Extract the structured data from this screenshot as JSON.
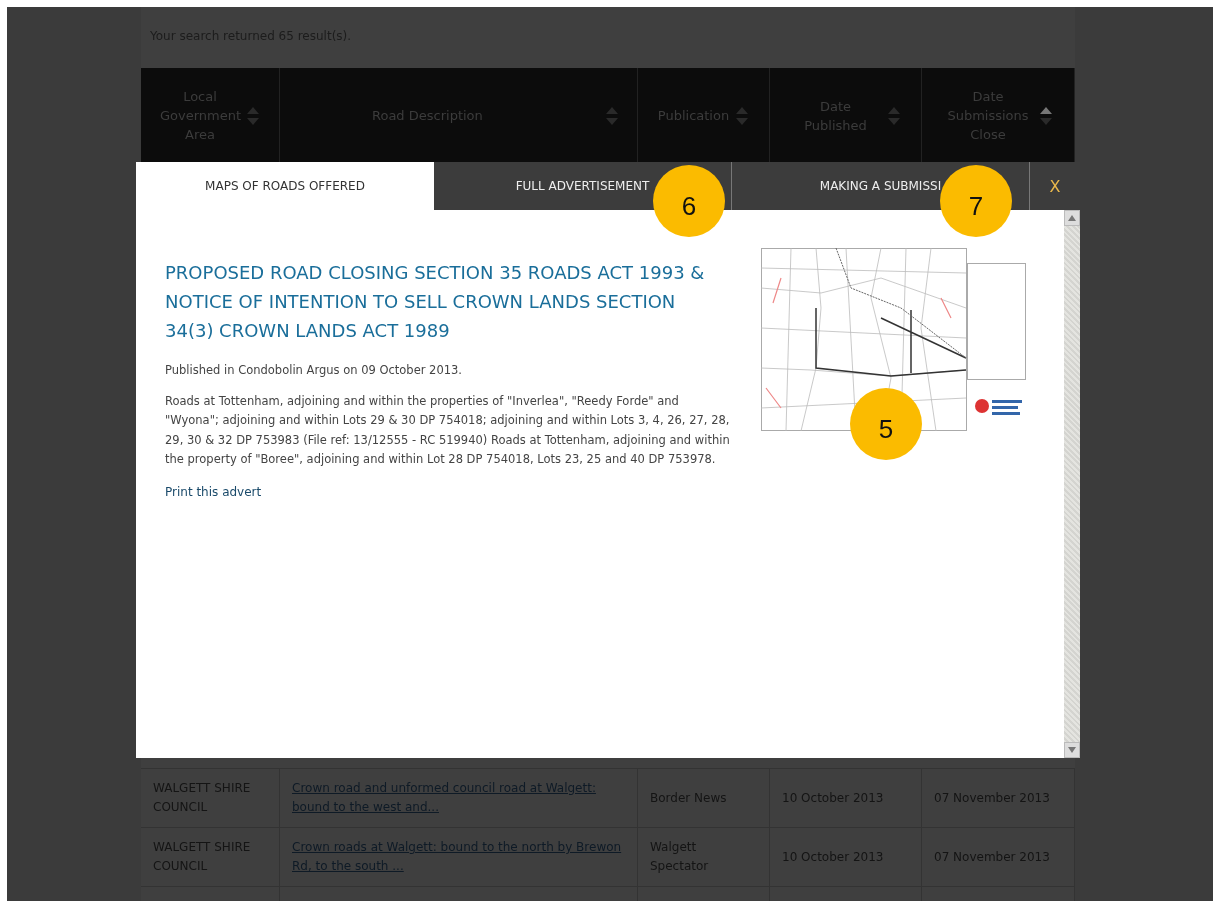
{
  "results_summary": "Your search returned 65 result(s).",
  "table": {
    "columns": [
      {
        "label": "Local Government Area",
        "sorted_ascending": false
      },
      {
        "label": "Road Description",
        "sorted_ascending": false
      },
      {
        "label": "Publication",
        "sorted_ascending": false
      },
      {
        "label": "Date Published",
        "sorted_ascending": false
      },
      {
        "label": "Date Submissions Close",
        "sorted_ascending": true
      }
    ],
    "rows": [
      {
        "council": "WALGETT SHIRE COUNCIL",
        "description": "Crown road and unformed council road at Walgett: bound to the west and...",
        "publication": "Border News",
        "date_published": "10 October 2013",
        "date_close": "07 November 2013"
      },
      {
        "council": "WALGETT SHIRE COUNCIL",
        "description": "Crown roads at Walgett: bound to the north by Brewon Rd, to the south ...",
        "publication": "Walgett Spectator",
        "date_published": "10 October 2013",
        "date_close": "07 November 2013"
      }
    ]
  },
  "modal": {
    "tabs": [
      {
        "label": "MAPS OF ROADS OFFERED",
        "selected": true
      },
      {
        "label": "FULL ADVERTISEMENT",
        "selected": false
      },
      {
        "label": "MAKING A SUBMISSI",
        "selected": false
      }
    ],
    "close": "X",
    "title": "PROPOSED ROAD CLOSING SECTION 35 ROADS ACT 1993 & NOTICE OF INTENTION TO SELL CROWN LANDS SECTION 34(3) CROWN LANDS ACT 1989",
    "published": "Published in Condobolin Argus on 09 October 2013.",
    "body": "Roads at Tottenham, adjoining and within the properties of \"Inverlea\", \"Reedy Forde\" and \"Wyona\"; adjoining and within Lots 29 & 30 DP 754018; adjoining and within Lots 3, 4, 26, 27, 28, 29, 30 & 32 DP 753983 (File ref: 13/12555 - RC 519940) Roads at Tottenham, adjoining and within the property of \"Boree\", adjoining and within Lot 28 DP 754018, Lots 23, 25 and 40 DP 753978.",
    "print_link": "Print this advert"
  },
  "markers": [
    {
      "label": "6"
    },
    {
      "label": "7"
    },
    {
      "label": "5"
    }
  ]
}
